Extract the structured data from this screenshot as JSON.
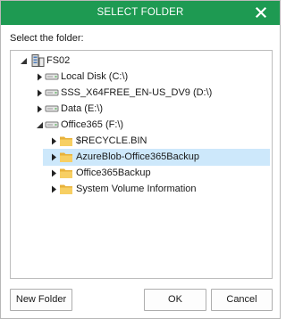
{
  "dialog": {
    "title": "SELECT FOLDER",
    "prompt": "Select the folder:"
  },
  "tree": {
    "server": {
      "label": "FS02",
      "icon": "server-icon"
    },
    "drives": [
      {
        "label": "Local Disk (C:\\)",
        "icon": "drive-icon",
        "expanded": false
      },
      {
        "label": "SSS_X64FREE_EN-US_DV9 (D:\\)",
        "icon": "drive-icon",
        "expanded": false
      },
      {
        "label": "Data (E:\\)",
        "icon": "drive-icon",
        "expanded": false
      },
      {
        "label": "Office365 (F:\\)",
        "icon": "drive-icon",
        "expanded": true
      }
    ],
    "folders": [
      {
        "label": "$RECYCLE.BIN",
        "icon": "folder-icon",
        "selected": false
      },
      {
        "label": "AzureBlob-Office365Backup",
        "icon": "folder-icon",
        "selected": true
      },
      {
        "label": "Office365Backup",
        "icon": "folder-icon",
        "selected": false
      },
      {
        "label": "System Volume Information",
        "icon": "folder-icon",
        "selected": false
      }
    ]
  },
  "buttons": {
    "new_folder": "New Folder",
    "ok": "OK",
    "cancel": "Cancel"
  },
  "colors": {
    "titlebar": "#1e9a52",
    "selection": "#cde8fb",
    "folder": "#f2c14e"
  }
}
